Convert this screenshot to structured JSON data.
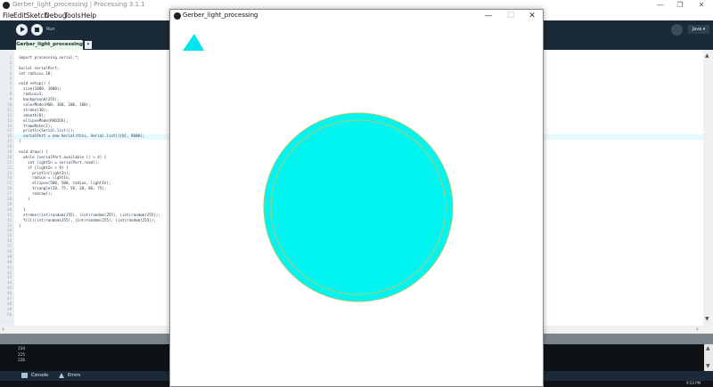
{
  "ide": {
    "title": "Gerber_light_processing | Processing 3.1.1",
    "window_controls": {
      "minimize": "—",
      "maximize": "❐",
      "close": "✕"
    },
    "menu": [
      "File",
      "Edit",
      "Sketch",
      "Debug",
      "Tools",
      "Help"
    ],
    "toolbar": {
      "run_label": "Run",
      "mode": "Java ▾"
    },
    "tabs": [
      {
        "label": "Gerber_light_processing"
      }
    ],
    "tab_menu": "▾",
    "editor": {
      "line_numbers": [
        "1",
        "2",
        "3",
        "4",
        "5",
        "6",
        "7",
        "8",
        "9",
        "10",
        "11",
        "12",
        "13",
        "14",
        "15",
        "16",
        "17",
        "18",
        "19",
        "20",
        "21",
        "22",
        "23",
        "24",
        "25",
        "26",
        "27",
        "28",
        "29",
        "30",
        "31",
        "32",
        "33",
        "34",
        "35",
        "36",
        "37",
        "38",
        "39",
        "40",
        "41",
        "42",
        "43",
        "44",
        "45",
        "46",
        "47",
        "48",
        "49",
        "50"
      ],
      "code_lines": [
        "import processing.serial.*;",
        "",
        "Serial serialPort;",
        "int radius= 10;",
        "",
        "void setup() {",
        "  size(1000, 1000);",
        "  radius=5;",
        "  background(255);",
        "  colorMode(HSB, 360, 100, 100);",
        "  stroke(30);",
        "  smooth(8);",
        "  ellipseMode(RADIUS);",
        "  frameRate(1);",
        "  println(Serial.list());",
        "  serialPort = new Serial(this, Serial.list()[0], 9600);",
        "}",
        "",
        "void draw() {",
        "  while (serialPort.available () > 4) {",
        "    int lightIn = serialPort.read();",
        "    if (lightIn > 9) {",
        "      println(lightIn);",
        "      radius = lightIn;",
        "      ellipse(500, 500, radius, lightIn);",
        "      triangle(20, 75, 58, 20, 86, 75);",
        "      redraw();",
        "    }",
        "",
        "  }",
        "  stroke((int)random(255), (int)random(255), (int)random(255));",
        "  fill((int)random(255), (int)random(255), (int)random(255));",
        "}"
      ]
    },
    "console": {
      "lines": [
        "234",
        "225",
        "226"
      ]
    },
    "console_tabs": {
      "console": "Console",
      "errors": "Errors"
    },
    "clock": "9:54 PM"
  },
  "sketch": {
    "title": "Gerber_light_processing",
    "window_controls": {
      "minimize": "—",
      "maximize": "☐",
      "close": "✕"
    },
    "colors": {
      "fill": "#00f5f0",
      "stroke": "#b8c86a",
      "triangle": "#00e6f0"
    }
  }
}
